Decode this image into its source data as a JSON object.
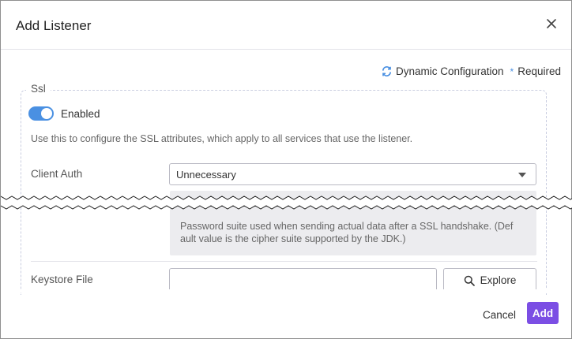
{
  "dialog": {
    "title": "Add Listener",
    "close_icon": "close-icon"
  },
  "meta": {
    "dynamic_icon": "refresh-icon",
    "dynamic_label": "Dynamic Configuration",
    "required_marker": "*",
    "required_label": "Required"
  },
  "ssl": {
    "legend": "Ssl",
    "toggle": {
      "label": "Enabled",
      "on": true
    },
    "description": "Use this to configure the SSL attributes, which apply to all services that use the listener.",
    "client_auth": {
      "label": "Client Auth",
      "value": "Unnecessary"
    },
    "cipher_help": "Password suite used when sending actual data after a SSL handshake.   (Def ault value is the cipher suite supported by the JDK.)",
    "keystore": {
      "label": "Keystore File",
      "value": "",
      "explore_label": "Explore",
      "explore_icon": "search-icon"
    }
  },
  "footer": {
    "cancel_label": "Cancel",
    "add_label": "Add"
  },
  "colors": {
    "accent": "#4a90e2",
    "primary_button": "#7b4ee4"
  }
}
